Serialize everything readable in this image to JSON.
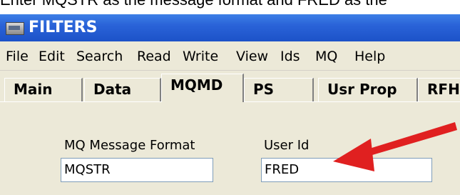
{
  "caption": "Enter MQSTR as the message format and FRED as the",
  "window": {
    "title": "FILTERS",
    "icon": "app-window-icon"
  },
  "menu": [
    "File",
    "Edit",
    "Search",
    "Read",
    "Write",
    "View",
    "Ids",
    "MQ",
    "Help"
  ],
  "tabs": [
    {
      "label": "Main",
      "active": false
    },
    {
      "label": "Data",
      "active": false
    },
    {
      "label": "MQMD",
      "active": true
    },
    {
      "label": "PS",
      "active": false
    },
    {
      "label": "Usr Prop",
      "active": false
    },
    {
      "label": "RFH",
      "active": false
    }
  ],
  "fields": {
    "format": {
      "label": "MQ Message Format",
      "value": "MQSTR"
    },
    "user": {
      "label": "User Id",
      "value": "FRED"
    }
  },
  "annotation": {
    "icon": "red-arrow-icon",
    "color": "#e02020"
  }
}
